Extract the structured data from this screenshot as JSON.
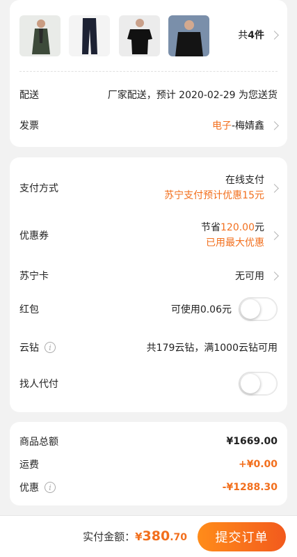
{
  "products": {
    "thumbnails": [
      "coat-model",
      "jeans",
      "black-tshirt-model",
      "black-sweater-model"
    ],
    "count_prefix": "共",
    "count": "4件"
  },
  "delivery": {
    "label": "配送",
    "value": "厂家配送，预计 2020-02-29 为您送货"
  },
  "invoice": {
    "label": "发票",
    "type": "电子",
    "name": "-梅婧鑫"
  },
  "payment": {
    "label": "支付方式",
    "method": "在线支付",
    "promo": "苏宁支付预计优惠15元"
  },
  "coupon": {
    "label": "优惠券",
    "save_prefix": "节省",
    "save_amount": "120.00",
    "save_suffix": "元",
    "status": "已用最大优惠"
  },
  "suning_card": {
    "label": "苏宁卡",
    "value": "无可用"
  },
  "red_packet": {
    "label": "红包",
    "value": "可使用0.06元"
  },
  "cloud_diamond": {
    "label": "云钻",
    "value": "共179云钻，满1000云钻可用"
  },
  "pay_for_me": {
    "label": "找人代付"
  },
  "summary": {
    "total_label": "商品总额",
    "total_value": "¥1669.00",
    "shipping_label": "运费",
    "shipping_value": "+¥0.00",
    "discount_label": "优惠",
    "discount_value": "-¥1288.30"
  },
  "bottom": {
    "amount_label": "实付金额：",
    "currency": "¥",
    "amount_int": "380",
    "amount_dec": ".70",
    "submit_label": "提交订单"
  },
  "colors": {
    "accent": "#f26f1d",
    "background": "#f2f2f2"
  }
}
